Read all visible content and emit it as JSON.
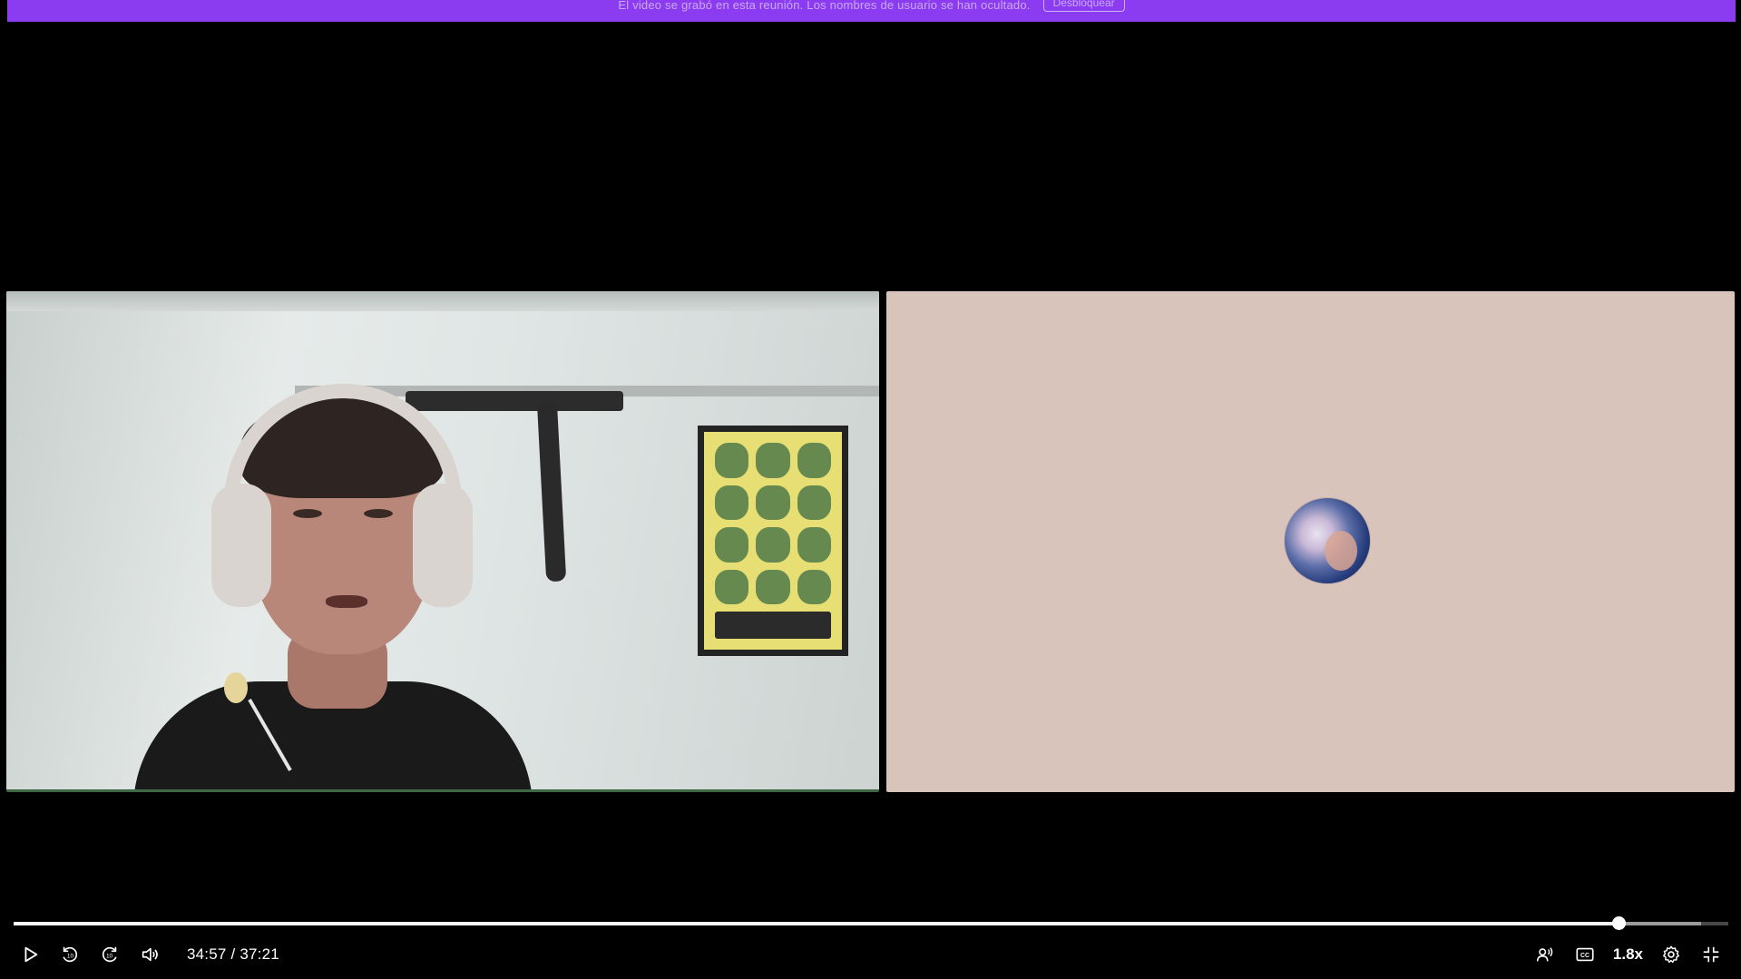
{
  "banner": {
    "text": "El video se grabó en esta reunión. Los nombres de usuario se han ocultado.",
    "button_label": "Desbloquear"
  },
  "player": {
    "current_time": "34:57",
    "separator": "/",
    "duration": "37:21",
    "speed": "1.8x",
    "progress_fraction": 0.936,
    "accent_color": "#8b3cf0"
  },
  "icons": {
    "play": "play-icon",
    "rewind": "rewind-10-icon",
    "forward": "forward-10-icon",
    "volume": "volume-icon",
    "voice": "voice-icon",
    "captions": "captions-icon",
    "settings": "settings-icon",
    "fullscreen": "exit-fullscreen-icon"
  }
}
